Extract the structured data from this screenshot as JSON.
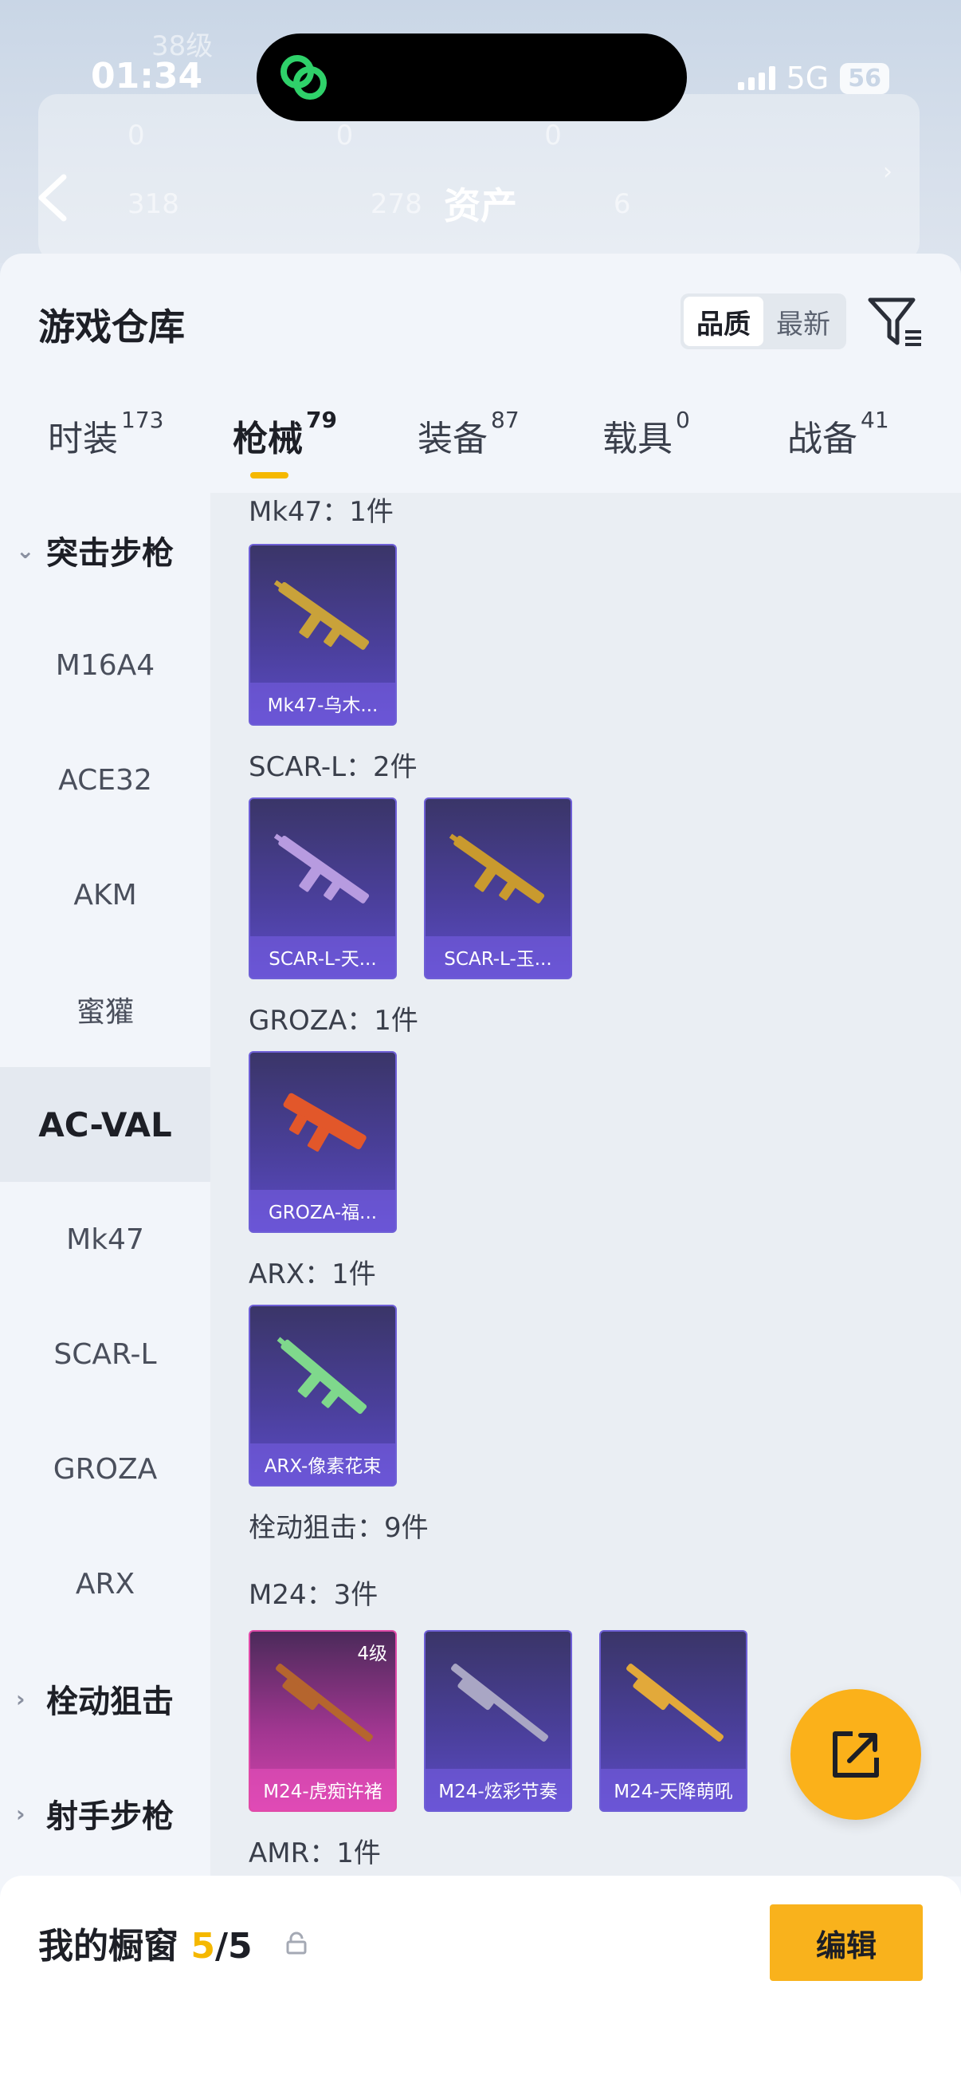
{
  "status": {
    "time": "01:34",
    "network": "5G",
    "battery": "56"
  },
  "header": {
    "title": "资产",
    "blur_row1": [
      "38级",
      "0",
      "0",
      "0"
    ],
    "blur_row2": [
      "318",
      "278",
      "6"
    ]
  },
  "panel": {
    "title": "游戏仓库",
    "sort_options": [
      "品质",
      "最新"
    ],
    "sort_selected": "品质"
  },
  "tabs": [
    {
      "label": "时装",
      "count": "173"
    },
    {
      "label": "枪械",
      "count": "79"
    },
    {
      "label": "装备",
      "count": "87"
    },
    {
      "label": "载具",
      "count": "0"
    },
    {
      "label": "战备",
      "count": "41"
    }
  ],
  "sidebar": [
    {
      "label": "突击步枪",
      "type": "group"
    },
    {
      "label": "M16A4"
    },
    {
      "label": "ACE32"
    },
    {
      "label": "AKM"
    },
    {
      "label": "蜜獾"
    },
    {
      "label": "AC-VAL",
      "selected": true
    },
    {
      "label": "Mk47"
    },
    {
      "label": "SCAR-L"
    },
    {
      "label": "GROZA"
    },
    {
      "label": "ARX"
    },
    {
      "label": "栓动狙击",
      "type": "group"
    },
    {
      "label": "射手步枪",
      "type": "group"
    }
  ],
  "sections": [
    {
      "label": "Mk47：1件"
    },
    {
      "label": "SCAR-L：2件"
    },
    {
      "label": "GROZA：1件"
    },
    {
      "label": "ARX：1件"
    },
    {
      "label": "栓动狙击：9件"
    },
    {
      "label": "M24：3件"
    },
    {
      "label": "AMR：1件"
    }
  ],
  "items": [
    {
      "name": "Mk47-乌木...",
      "gun_color": "#c9a23a"
    },
    {
      "name": "SCAR-L-天...",
      "gun_color": "#b79be0"
    },
    {
      "name": "SCAR-L-玉...",
      "gun_color": "#c99a2e"
    },
    {
      "name": "GROZA-福...",
      "gun_color": "#e2572a"
    },
    {
      "name": "ARX-像素花束",
      "gun_color": "#7fd88c"
    },
    {
      "name": "M24-虎痴许褚",
      "level": "4级",
      "gun_color": "#b5652e"
    },
    {
      "name": "M24-炫彩节奏",
      "gun_color": "#a9a6c4"
    },
    {
      "name": "M24-天降萌吼",
      "gun_color": "#e2a93a"
    }
  ],
  "bottom": {
    "title": "我的橱窗",
    "count": "5",
    "total": "/5",
    "edit_label": "编辑"
  },
  "colors": {
    "accent": "#f5b800",
    "purple_card": "#5b4bc4",
    "pink_card": "#d344ac"
  }
}
